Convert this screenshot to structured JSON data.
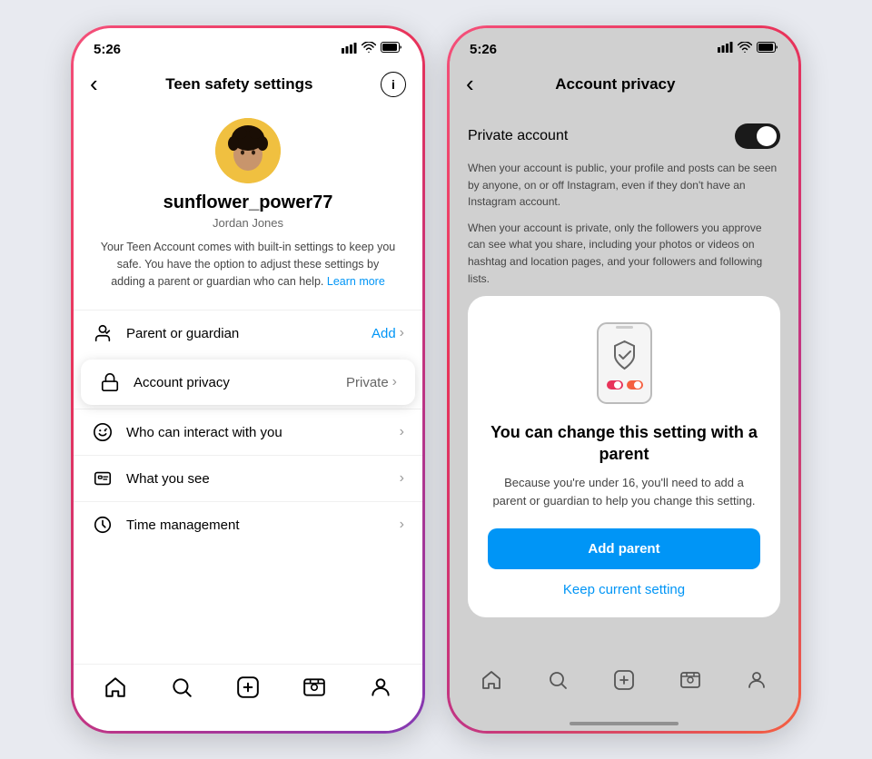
{
  "left_phone": {
    "status_bar": {
      "time": "5:26",
      "signal": "▲▲▲",
      "wifi": "wifi",
      "battery": "battery"
    },
    "header": {
      "back": "‹",
      "title": "Teen safety settings",
      "info": "i"
    },
    "profile": {
      "username": "sunflower_power77",
      "realname": "Jordan Jones",
      "description": "Your Teen Account comes with built-in settings to keep you safe. You have the option to adjust these settings by adding a parent or guardian who can help.",
      "learn_more": "Learn more"
    },
    "settings": [
      {
        "icon": "person-icon",
        "label": "Parent or guardian",
        "value": "Add",
        "has_chevron": true
      },
      {
        "icon": "lock-icon",
        "label": "Account privacy",
        "value": "Private",
        "has_chevron": true,
        "highlighted": true
      },
      {
        "icon": "interact-icon",
        "label": "Who can interact with you",
        "value": "",
        "has_chevron": true
      },
      {
        "icon": "eye-icon",
        "label": "What you see",
        "value": "",
        "has_chevron": true
      },
      {
        "icon": "clock-icon",
        "label": "Time management",
        "value": "",
        "has_chevron": true
      }
    ],
    "bottom_nav": [
      "home",
      "search",
      "add",
      "reels",
      "profile"
    ]
  },
  "right_phone": {
    "status_bar": {
      "time": "5:26"
    },
    "header": {
      "back": "‹",
      "title": "Account privacy"
    },
    "private_account": {
      "label": "Private account",
      "toggle_on": true
    },
    "desc1": "When your account is public, your profile and posts can be seen by anyone, on or off Instagram, even if they don't have an Instagram account.",
    "desc2": "When your account is private, only the followers you approve can see what you share, including your photos or videos on hashtag and location pages, and your followers and following lists.",
    "modal": {
      "title": "You can change this setting with a parent",
      "description": "Because you're under 16, you'll need to add a parent or guardian to help you change this setting.",
      "add_parent_label": "Add parent",
      "keep_current_label": "Keep current setting"
    },
    "bottom_nav": [
      "home",
      "search",
      "add",
      "reels",
      "profile"
    ]
  }
}
